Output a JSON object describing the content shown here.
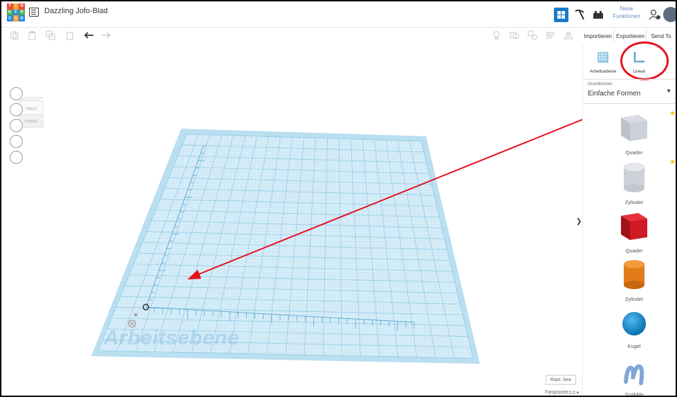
{
  "app": {
    "logo_letters": [
      "T",
      "I",
      "N",
      "K",
      "E",
      "R",
      "C",
      "A",
      "D"
    ],
    "logo_colors": [
      "#e84a3c",
      "#f49e28",
      "#e84a3c",
      "#4caf50",
      "#1e88e5",
      "#4caf50",
      "#1e88e5",
      "#f49e28",
      "#1e88e5"
    ],
    "project_title": "Dazzling Jofo-Blad",
    "new_features_line1": "Neue",
    "new_features_line2": "Funktionen"
  },
  "toolbar": {
    "import_label": "Importieren",
    "export_label": "Exportieren",
    "send_to_label": "Send To"
  },
  "panel": {
    "workplane_label": "Arbeitsebene",
    "ruler_label": "Lineal",
    "category_small": "Grundformen",
    "category_value": "Einfache Formen",
    "shapes": [
      {
        "label": "Quader",
        "icon": "box-gray-striped-icon"
      },
      {
        "label": "Zylinder",
        "icon": "cylinder-gray-striped-icon"
      },
      {
        "label": "Quader",
        "icon": "box-red-icon"
      },
      {
        "label": "Zylinder",
        "icon": "cylinder-orange-icon"
      },
      {
        "label": "Kugel",
        "icon": "sphere-blue-icon"
      },
      {
        "label": "Scribble",
        "icon": "scribble-icon"
      }
    ]
  },
  "viewport": {
    "viewcube_top": "OBEN",
    "viewcube_front": "VORNE",
    "workplane_watermark": "Arbeitsebene",
    "snap_label": "Rast. bea",
    "snap_grid_label": "Fangraster",
    "snap_grid_value": "2,0 ▾"
  },
  "colors": {
    "accent": "#1a7ac6",
    "annotation_red": "#e8101d",
    "grid_fill": "#cfe9f6",
    "grid_line": "#8cc7e6"
  }
}
